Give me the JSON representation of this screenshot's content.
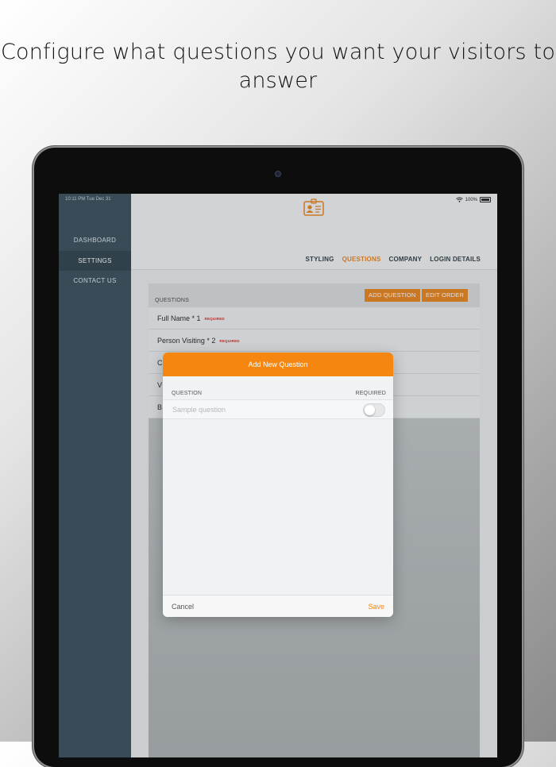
{
  "headline": "Configure what questions you want your visitors to answer",
  "status_bar": {
    "time_date": "10:11 PM  Tue Dec 31",
    "battery": "100%"
  },
  "sidebar": {
    "items": [
      {
        "label": "DASHBOARD"
      },
      {
        "label": "SETTINGS",
        "active": true
      },
      {
        "label": "CONTACT US"
      }
    ]
  },
  "tabs": [
    {
      "label": "STYLING"
    },
    {
      "label": "QUESTIONS",
      "active": true
    },
    {
      "label": "COMPANY"
    },
    {
      "label": "LOGIN DETAILS"
    }
  ],
  "questions_panel": {
    "header_label": "QUESTIONS",
    "add_button": "ADD QUESTION",
    "edit_button": "EDIT ORDER",
    "rows": [
      {
        "text": "Full Name * 1",
        "badge": "REQUIRED"
      },
      {
        "text": "Person Visiting * 2",
        "badge": "REQUIRED"
      },
      {
        "text": "C"
      },
      {
        "text": "V"
      },
      {
        "text": "B"
      }
    ]
  },
  "modal": {
    "title": "Add New Question",
    "question_label": "QUESTION",
    "required_label": "REQUIRED",
    "input_placeholder": "Sample question",
    "input_value": "",
    "required_toggle": false,
    "cancel": "Cancel",
    "save": "Save"
  },
  "colors": {
    "accent": "#f5860f",
    "sidebar": "#354b58",
    "required_badge": "#d0261c"
  },
  "icons": {
    "logo": "visitor-badge-icon",
    "wifi": "wifi-icon",
    "battery": "battery-icon"
  }
}
